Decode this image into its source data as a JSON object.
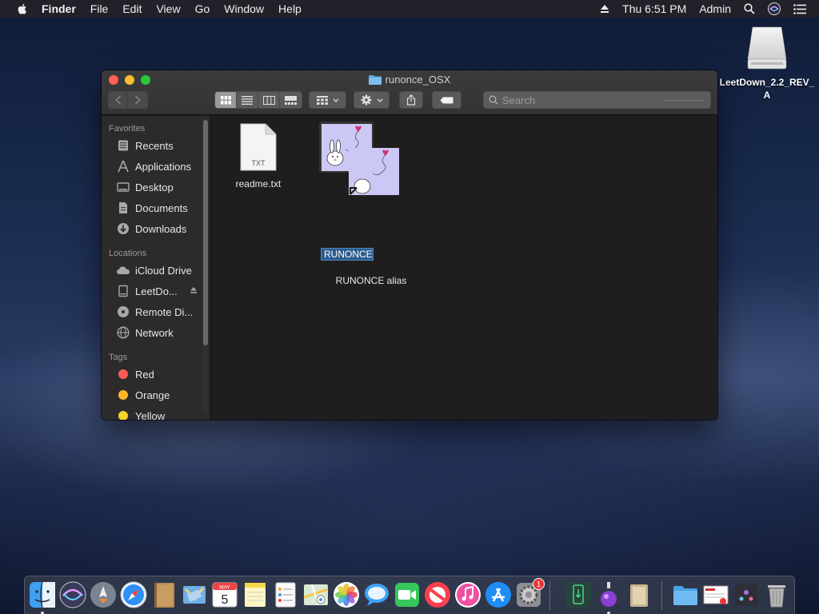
{
  "menubar": {
    "app": "Finder",
    "items": [
      "File",
      "Edit",
      "View",
      "Go",
      "Window",
      "Help"
    ],
    "clock": "Thu 6:51 PM",
    "user": "Admin"
  },
  "desktop": {
    "drive_label": "LeetDown_2.2_REV_A"
  },
  "window": {
    "title": "runonce_OSX",
    "search_placeholder": "Search"
  },
  "sidebar": {
    "favorites_title": "Favorites",
    "favorites": [
      "Recents",
      "Applications",
      "Desktop",
      "Documents",
      "Downloads"
    ],
    "locations_title": "Locations",
    "locations": [
      "iCloud Drive",
      "LeetDo...",
      "Remote Di...",
      "Network"
    ],
    "tags_title": "Tags",
    "tags": [
      {
        "label": "Red",
        "color": "#ff5b55"
      },
      {
        "label": "Orange",
        "color": "#fdb62a"
      },
      {
        "label": "Yellow",
        "color": "#f7d229"
      }
    ]
  },
  "files": [
    {
      "name": "readme.txt",
      "badge": "TXT"
    },
    {
      "name": "RUNONCE"
    },
    {
      "name": "RUNONCE alias"
    }
  ],
  "dock": {
    "apps": [
      "finder-icon",
      "siri-icon",
      "launchpad-icon",
      "safari-icon",
      "notebook-icon",
      "mail-icon",
      "calendar-icon",
      "notes-icon",
      "reminders-icon",
      "maps-icon",
      "photos-icon",
      "messages-icon",
      "facetime-icon",
      "news-icon",
      "itunes-icon",
      "app-store-icon",
      "system-preferences-icon",
      "downloader-icon",
      "potion-icon",
      "keychain-icon",
      "folder-icon",
      "preview-icon",
      "utility-icon",
      "trash-icon"
    ],
    "calendar_month": "MAY",
    "calendar_day": "5",
    "prefs_badge": "1"
  }
}
